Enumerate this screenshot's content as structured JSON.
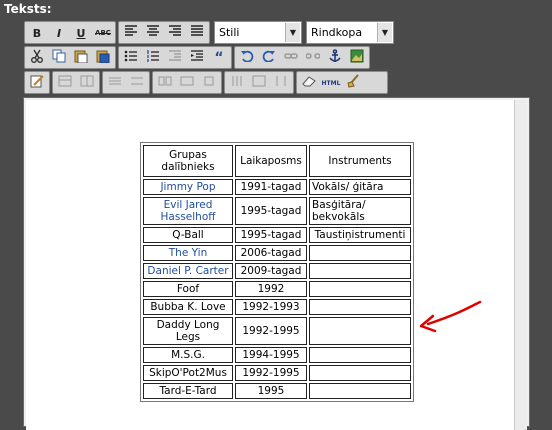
{
  "field_label": "Teksts:",
  "toolbar": {
    "row1": {
      "bold": "B",
      "italic": "I",
      "underline": "U",
      "strike": "ABC",
      "style_select": "Stili",
      "format_select": "Rindkopa"
    },
    "row2": {},
    "row3": {
      "html_button": "HTML"
    }
  },
  "icons": [
    "align-left-icon",
    "align-center-icon",
    "align-right-icon",
    "justify-icon",
    "cut-icon",
    "copy-icon",
    "paste-icon",
    "paste-word-icon",
    "bullet-list-icon",
    "numbered-list-icon",
    "outdent-icon",
    "indent-icon",
    "blockquote-icon",
    "undo-icon",
    "redo-icon",
    "link-icon",
    "unlink-icon",
    "anchor-icon",
    "image-icon",
    "edit-icon",
    "table-icon",
    "eraser-icon",
    "html-icon",
    "cleanup-icon"
  ],
  "table": {
    "headers": [
      "Grupas dalībnieks",
      "Laikaposms",
      "Instruments"
    ],
    "rows": [
      {
        "name": "Jimmy Pop",
        "period": "1991-tagad",
        "instrument": "Vokāls/ ģitāra",
        "link": true
      },
      {
        "name": "Evil Jared Hasselhoff",
        "period": "1995-tagad",
        "instrument": "Basģitāra/ bekvokāls",
        "link": true
      },
      {
        "name": "Q-Ball",
        "period": "1995-tagad",
        "instrument": "Taustiņistrumenti",
        "link": false
      },
      {
        "name": "The Yin",
        "period": "2006-tagad",
        "instrument": "",
        "link": true
      },
      {
        "name": "Daniel P. Carter",
        "period": "2009-tagad",
        "instrument": "",
        "link": true
      },
      {
        "name": "Foof",
        "period": "1992",
        "instrument": "",
        "link": false
      },
      {
        "name": "Bubba K. Love",
        "period": "1992-1993",
        "instrument": "",
        "link": false
      },
      {
        "name": "Daddy Long Legs",
        "period": "1992-1995",
        "instrument": "",
        "link": false
      },
      {
        "name": "M.S.G.",
        "period": "1994-1995",
        "instrument": "",
        "link": false
      },
      {
        "name": "SkipO'Pot2Mus",
        "period": "1992-1995",
        "instrument": "",
        "link": false
      },
      {
        "name": "Tard-E-Tard",
        "period": "1995",
        "instrument": "",
        "link": false
      }
    ]
  },
  "colors": {
    "background": "#4a4a4a",
    "toolbar": "#d8d8d8",
    "link": "#1f4e9a",
    "arrow": "#e00000"
  }
}
